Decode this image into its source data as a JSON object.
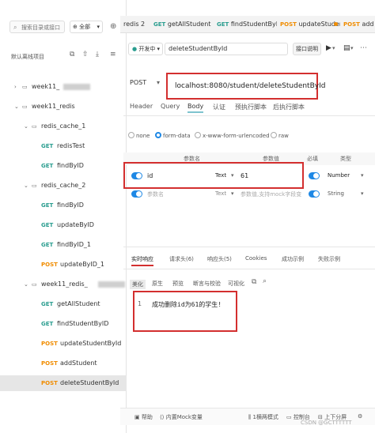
{
  "sidebar": {
    "search_placeholder": "搜索目录或接口",
    "scope": "全部",
    "default_env": "默认离线项目",
    "tree": [
      {
        "kind": "folder",
        "level": 0,
        "name": "week11_",
        "blurred": true,
        "collapsed": true
      },
      {
        "kind": "folder",
        "level": 0,
        "name": "week11_redis",
        "blurred": false,
        "collapsed": false
      },
      {
        "kind": "folder",
        "level": 1,
        "name": "redis_cache_1",
        "blurred": false,
        "collapsed": false
      },
      {
        "kind": "request",
        "level": 2,
        "method": "GET",
        "name": "redisTest"
      },
      {
        "kind": "request",
        "level": 2,
        "method": "GET",
        "name": "findByID"
      },
      {
        "kind": "folder",
        "level": 1,
        "name": "redis_cache_2",
        "blurred": false,
        "collapsed": false
      },
      {
        "kind": "request",
        "level": 2,
        "method": "GET",
        "name": "findByID"
      },
      {
        "kind": "request",
        "level": 2,
        "method": "GET",
        "name": "updateByID"
      },
      {
        "kind": "request",
        "level": 2,
        "method": "GET",
        "name": "findByID_1"
      },
      {
        "kind": "request",
        "level": 2,
        "method": "POST",
        "name": "updateByID_1"
      },
      {
        "kind": "folder",
        "level": 1,
        "name": "week11_redis_",
        "blurred": true,
        "collapsed": false
      },
      {
        "kind": "request",
        "level": 2,
        "method": "GET",
        "name": "getAllStudent"
      },
      {
        "kind": "request",
        "level": 2,
        "method": "GET",
        "name": "findStudentByID"
      },
      {
        "kind": "request",
        "level": 2,
        "method": "POST",
        "name": "updateStudentById"
      },
      {
        "kind": "request",
        "level": 2,
        "method": "POST",
        "name": "addStudent"
      },
      {
        "kind": "request",
        "level": 2,
        "method": "POST",
        "name": "deleteStudentById",
        "selected": true
      }
    ]
  },
  "tabs": [
    {
      "method": "",
      "name": "redis 2"
    },
    {
      "method": "GET",
      "name": "getAllStudent"
    },
    {
      "method": "GET",
      "name": "findStudentByI"
    },
    {
      "method": "POST",
      "name": "updateStuder",
      "dot": true
    },
    {
      "method": "POST",
      "name": "add"
    }
  ],
  "request": {
    "status": "开发中",
    "title": "deleteStudentById",
    "doc_button": "接口说明",
    "method": "POST",
    "url": "localhost:8080/student/deleteStudentById",
    "subtabs": [
      "Header",
      "Query",
      "Body",
      "认证",
      "预执行脚本",
      "后执行脚本"
    ],
    "active_subtab": "Body",
    "body_types": [
      "none",
      "form-data",
      "x-www-form-urlencoded",
      "raw"
    ],
    "active_body_type": "form-data",
    "param_columns": [
      "参数名",
      "参数值",
      "必填",
      "类型"
    ],
    "params": [
      {
        "name": "id",
        "type_hint": "Text",
        "value": "61",
        "value_type": "Number"
      },
      {
        "name": "参数名",
        "type_hint": "Text",
        "value": "参数值,支持mock字段变",
        "value_type": "String",
        "placeholder": true
      }
    ]
  },
  "response": {
    "tabs": [
      "实时响应",
      "请求头(6)",
      "响应头(5)",
      "Cookies",
      "成功示例",
      "失败示例"
    ],
    "active_tab": "实时响应",
    "view_tabs": [
      "美化",
      "原生",
      "预览",
      "断言与校验",
      "可视化"
    ],
    "active_view_tab": "美化",
    "line_number": "1",
    "body": "成功删除id为61的学生!"
  },
  "footer": {
    "help": "帮助",
    "mock": "内置Mock变量",
    "divider_mode": "上下分屏",
    "layout_mode": "1横两模式",
    "console": "控制台",
    "split": "上下分屏"
  },
  "watermark": "CSDN @GCTTTTTT"
}
